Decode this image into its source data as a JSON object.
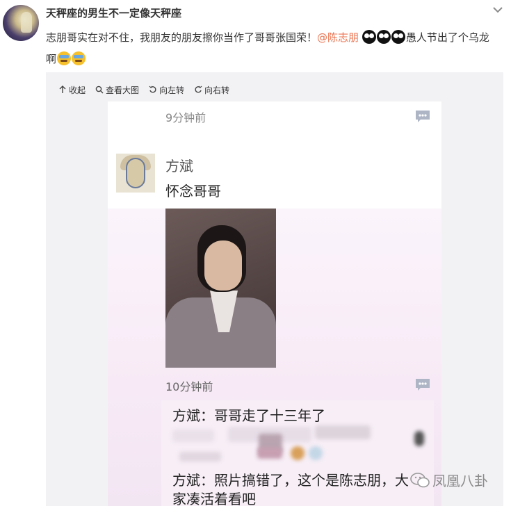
{
  "post": {
    "username": "天秤座的男生不一定像天秤座",
    "text_before": "志朋哥实在对不住，我朋友的朋友擦你当作了哥哥张国荣！",
    "mention": "@陈志朋",
    "text_after": "愚人节出了个乌龙",
    "text_line2": "啊"
  },
  "toolbar": {
    "collapse_label": "收起",
    "view_large_label": "查看大图",
    "rotate_left_label": "向左转",
    "rotate_right_label": "向右转"
  },
  "screenshot": {
    "time_top": "9分钟前",
    "commenter_name": "方斌",
    "message": "怀念哥哥",
    "time_second": "10分钟前",
    "reply1": "方斌：哥哥走了十三年了",
    "reply3_line1": "方斌：照片搞错了，这个是陈志朋，大",
    "reply3_line2": "家凑活着看吧"
  },
  "watermark": {
    "text": "凤凰八卦"
  },
  "colors": {
    "mention": "#eb7350",
    "panel_bg": "#f2f2f5"
  }
}
